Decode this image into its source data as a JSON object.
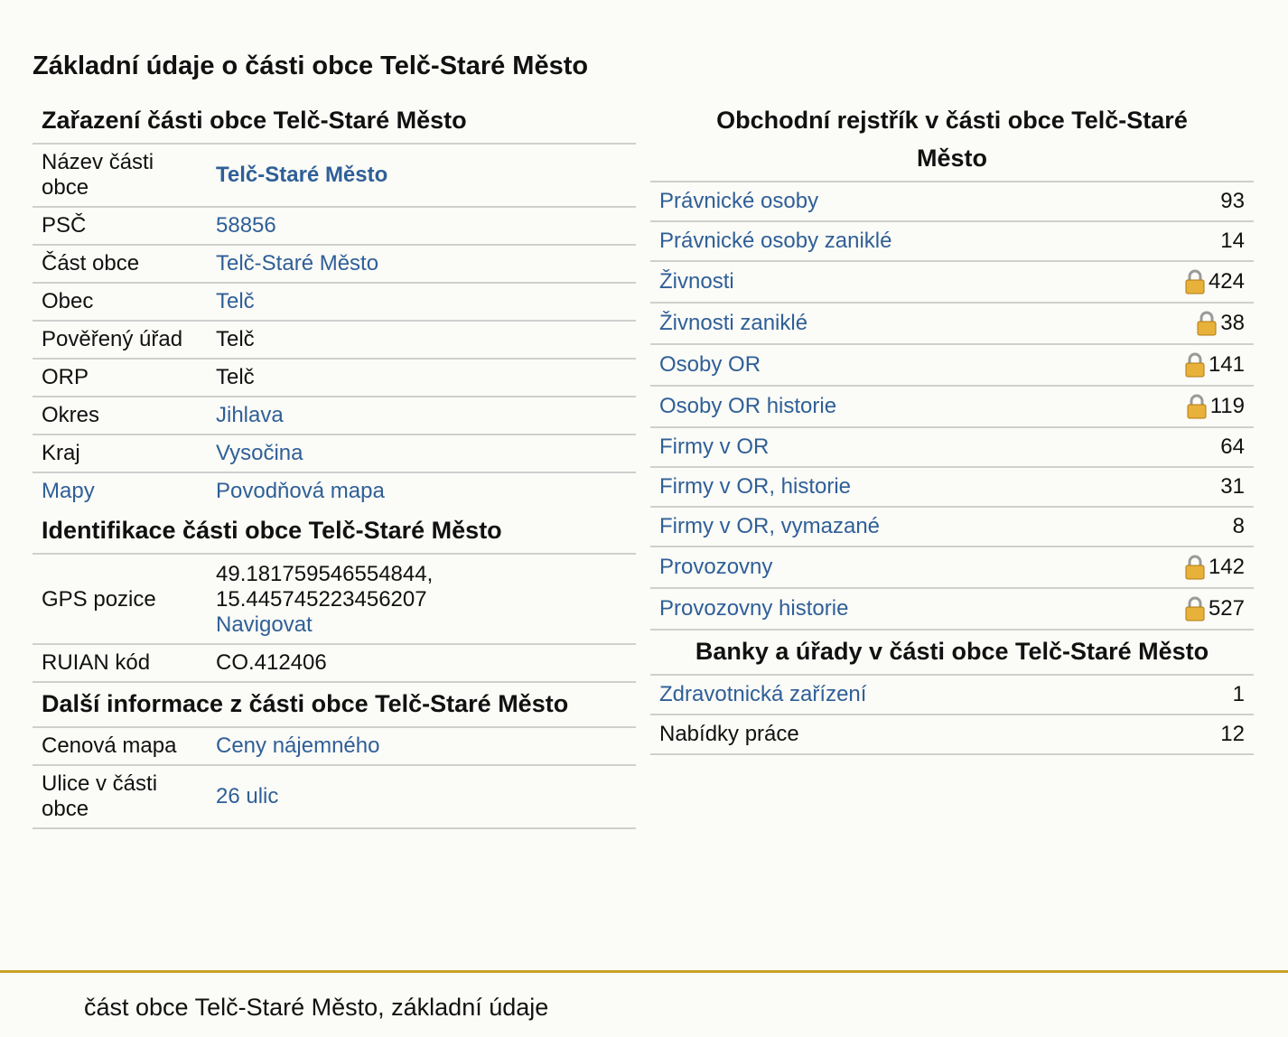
{
  "page_title": "Základní údaje o části obce Telč-Staré Město",
  "zarazeni": {
    "title": "Zařazení části obce Telč-Staré Město",
    "rows": [
      {
        "key": "Název části obce",
        "value": "Telč-Staré Město"
      },
      {
        "key": "PSČ",
        "value": "58856"
      },
      {
        "key": "Část obce",
        "value": "Telč-Staré Město"
      },
      {
        "key": "Obec",
        "value": "Telč"
      },
      {
        "key": "Pověřený úřad",
        "value": "Telč"
      },
      {
        "key": "ORP",
        "value": "Telč"
      },
      {
        "key": "Okres",
        "value": "Jihlava"
      },
      {
        "key": "Kraj",
        "value": "Vysočina"
      },
      {
        "key": "Mapy",
        "value": "Povodňová mapa"
      }
    ]
  },
  "identifikace": {
    "title": "Identifikace části obce Telč-Staré Město",
    "gps_key": "GPS pozice",
    "gps_lat": "49.181759546554844,",
    "gps_lon": "15.445745223456207",
    "gps_link": "Navigovat",
    "ruian_key": "RUIAN kód",
    "ruian_value": "CO.412406"
  },
  "dalsi": {
    "title": "Další informace z části obce Telč-Staré Město",
    "rows": [
      {
        "key": "Cenová mapa",
        "value": "Ceny nájemného"
      },
      {
        "key": "Ulice v části obce",
        "value": "26 ulic"
      }
    ]
  },
  "obchodni": {
    "title": "Obchodní rejstřík v části obce Telč-Staré Město",
    "rows": [
      {
        "label": "Právnické osoby",
        "count": "93",
        "locked": false
      },
      {
        "label": "Právnické osoby zaniklé",
        "count": "14",
        "locked": false
      },
      {
        "label": "Živnosti",
        "count": "424",
        "locked": true
      },
      {
        "label": "Živnosti zaniklé",
        "count": "38",
        "locked": true
      },
      {
        "label": "Osoby OR",
        "count": "141",
        "locked": true
      },
      {
        "label": "Osoby OR historie",
        "count": "119",
        "locked": true
      },
      {
        "label": "Firmy v OR",
        "count": "64",
        "locked": false
      },
      {
        "label": "Firmy v OR, historie",
        "count": "31",
        "locked": false
      },
      {
        "label": "Firmy v OR, vymazané",
        "count": "8",
        "locked": false
      },
      {
        "label": "Provozovny",
        "count": "142",
        "locked": true
      },
      {
        "label": "Provozovny historie",
        "count": "527",
        "locked": true
      }
    ]
  },
  "banky": {
    "title": "Banky a úřady v části obce Telč-Staré Město",
    "rows": [
      {
        "label": "Zdravotnická zařízení",
        "count": "1"
      },
      {
        "label": "Nabídky práce",
        "count": "12"
      }
    ]
  },
  "footer_text": "část obce Telč-Staré Město, základní údaje",
  "colors": {
    "link": "#2f5f97",
    "footer_rule": "#c9a227",
    "lock": "#e8b23a"
  }
}
